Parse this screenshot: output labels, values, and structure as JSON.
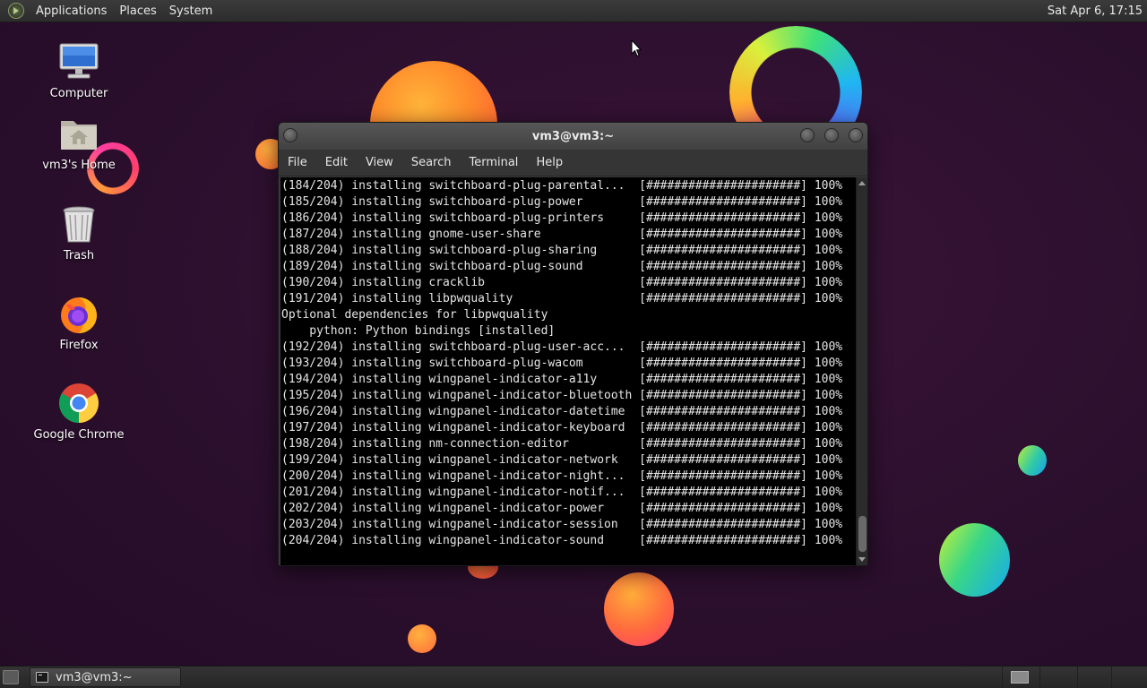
{
  "top_panel": {
    "menus": [
      "Applications",
      "Places",
      "System"
    ],
    "clock": "Sat Apr  6, 17:15"
  },
  "desktop": {
    "icons": [
      {
        "label": "Computer",
        "icon": "computer-icon"
      },
      {
        "label": "vm3's Home",
        "icon": "home-folder-icon"
      },
      {
        "label": "Trash",
        "icon": "trash-icon"
      },
      {
        "label": "Firefox",
        "icon": "firefox-icon"
      },
      {
        "label": "Google Chrome",
        "icon": "chrome-icon"
      }
    ]
  },
  "terminal": {
    "title": "vm3@vm3:~",
    "menu": [
      "File",
      "Edit",
      "View",
      "Search",
      "Terminal",
      "Help"
    ],
    "lines": [
      "(184/204) installing switchboard-plug-parental...  [######################] 100%",
      "(185/204) installing switchboard-plug-power        [######################] 100%",
      "(186/204) installing switchboard-plug-printers     [######################] 100%",
      "(187/204) installing gnome-user-share              [######################] 100%",
      "(188/204) installing switchboard-plug-sharing      [######################] 100%",
      "(189/204) installing switchboard-plug-sound        [######################] 100%",
      "(190/204) installing cracklib                      [######################] 100%",
      "(191/204) installing libpwquality                  [######################] 100%",
      "Optional dependencies for libpwquality",
      "    python: Python bindings [installed]",
      "(192/204) installing switchboard-plug-user-acc...  [######################] 100%",
      "(193/204) installing switchboard-plug-wacom        [######################] 100%",
      "(194/204) installing wingpanel-indicator-a11y      [######################] 100%",
      "(195/204) installing wingpanel-indicator-bluetooth [######################] 100%",
      "(196/204) installing wingpanel-indicator-datetime  [######################] 100%",
      "(197/204) installing wingpanel-indicator-keyboard  [######################] 100%",
      "(198/204) installing nm-connection-editor          [######################] 100%",
      "(199/204) installing wingpanel-indicator-network   [######################] 100%",
      "(200/204) installing wingpanel-indicator-night...  [######################] 100%",
      "(201/204) installing wingpanel-indicator-notif...  [######################] 100%",
      "(202/204) installing wingpanel-indicator-power     [######################] 100%",
      "(203/204) installing wingpanel-indicator-session   [######################] 100%",
      "(204/204) installing wingpanel-indicator-sound     [######################] 100%"
    ]
  },
  "bottom_panel": {
    "task_label": "vm3@vm3:~"
  },
  "colors": {
    "terminal_bg": "#000000",
    "terminal_fg": "#e5e5e5",
    "panel_bg": "#2f2f2f"
  }
}
